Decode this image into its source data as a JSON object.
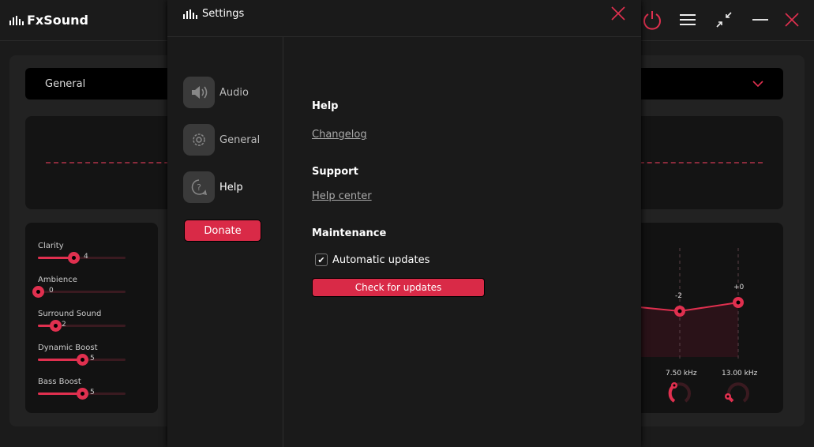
{
  "app": {
    "title": "FxSound"
  },
  "preset": {
    "selected": "General"
  },
  "effects": [
    {
      "label": "Clarity",
      "value": "4",
      "fraction": 0.4
    },
    {
      "label": "Ambience",
      "value": "0",
      "fraction": 0
    },
    {
      "label": "Surround Sound",
      "value": "2",
      "fraction": 0.2
    },
    {
      "label": "Dynamic Boost",
      "value": "5",
      "fraction": 0.5
    },
    {
      "label": "Bass Boost",
      "value": "5",
      "fraction": 0.5
    }
  ],
  "eq": {
    "bands": [
      {
        "gain": "-2",
        "freq": "7.50 kHz"
      },
      {
        "gain": "+0",
        "freq": "13.00 kHz"
      }
    ]
  },
  "settings": {
    "title": "Settings",
    "nav": [
      {
        "label": "Audio"
      },
      {
        "label": "General"
      },
      {
        "label": "Help"
      }
    ],
    "donate": "Donate",
    "help_heading": "Help",
    "changelog": "Changelog",
    "support_heading": "Support",
    "help_center": "Help center",
    "maintenance_heading": "Maintenance",
    "auto_updates": "Automatic updates",
    "auto_updates_checked": true,
    "check_updates": "Check for updates"
  },
  "colors": {
    "accent": "#e0304f",
    "button": "#d92a47"
  }
}
